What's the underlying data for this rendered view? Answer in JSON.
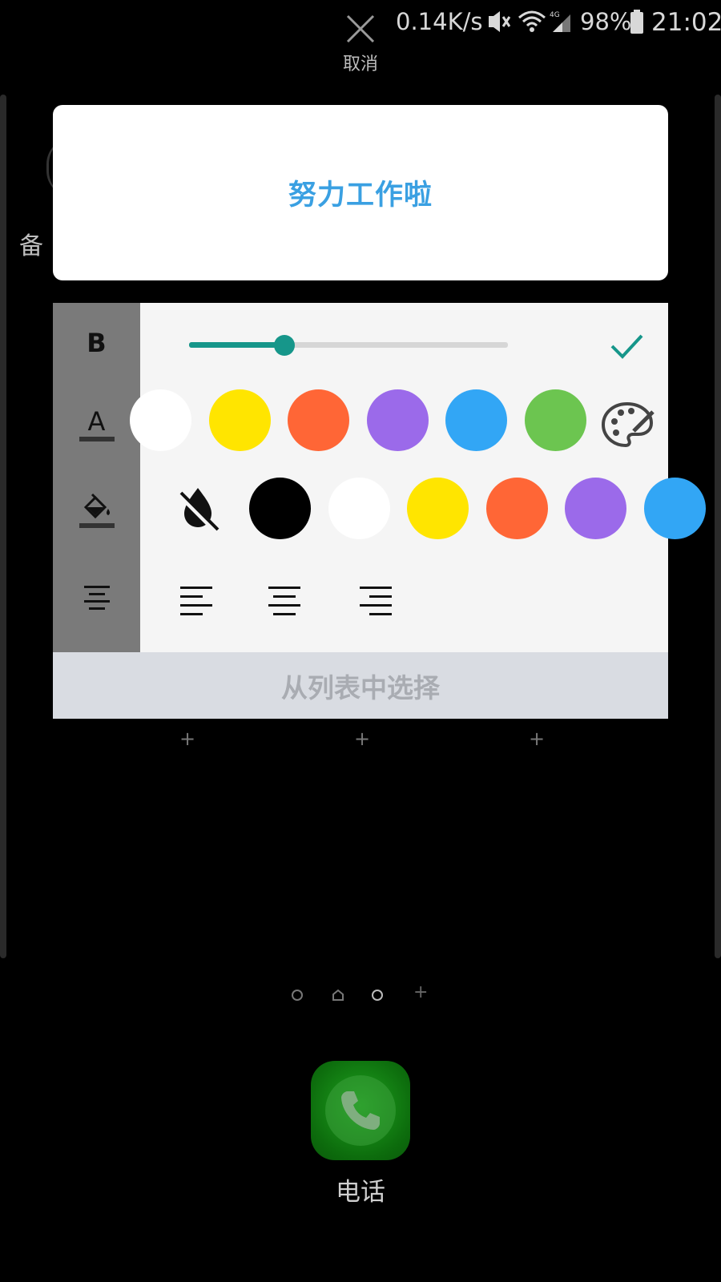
{
  "status_bar": {
    "net_speed": "0.14K/s",
    "battery": "98%",
    "time": "21:02",
    "icons": [
      "vibrate-off-icon",
      "wifi-icon",
      "signal-4g-icon",
      "battery-icon"
    ]
  },
  "cancel": {
    "label": "取消",
    "icon": "close-icon"
  },
  "background": {
    "partial_label": "备"
  },
  "preview": {
    "text": "努力工作啦",
    "text_color": "#3aa0e2"
  },
  "format_panel": {
    "tools": [
      "bold-icon",
      "text-color-icon",
      "fill-color-icon",
      "align-center-icon"
    ],
    "bold_label": "B",
    "text_color_label": "A",
    "size_slider": {
      "value": 0.3
    },
    "text_colors": [
      "#ffffff",
      "#ffe500",
      "#ff6636",
      "#9b6aea",
      "#32a6f5",
      "#6cc550"
    ],
    "fill_colors": [
      "#000000",
      "#ffffff",
      "#ffe500",
      "#ff6636",
      "#9b6aea",
      "#32a6f5"
    ],
    "accent": "#16968a",
    "align_options": [
      "align-left-icon",
      "align-center-icon",
      "align-right-icon"
    ]
  },
  "choose_list": {
    "label": "从列表中选择"
  },
  "dock": {
    "phone_label": "电话"
  }
}
